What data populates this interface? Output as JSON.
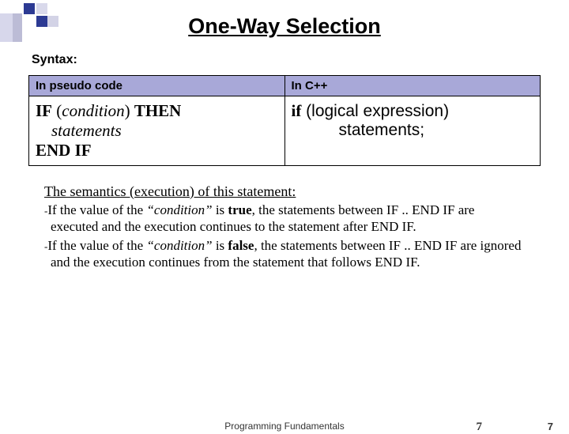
{
  "title": "One-Way Selection",
  "syntax_label": "Syntax:",
  "table": {
    "head_left": "In pseudo code",
    "head_right": "In C++",
    "pseudo": {
      "line1_kw1": "IF",
      "line1_paren_open": "  (",
      "line1_cond": "condition",
      "line1_paren_close": ") ",
      "line1_kw2": "THEN",
      "line2": "statements",
      "line3": "END IF"
    },
    "cpp": {
      "line1_kw": "if",
      "line1_rest": " (logical expression)",
      "line2": "statements;"
    }
  },
  "semantics": {
    "heading": "The semantics (execution) of this statement:",
    "p1_dash": "-",
    "p1_a": "If the value of the ",
    "p1_cond": "“condition”",
    "p1_b": " is ",
    "p1_true": "true",
    "p1_c": ", the statements between IF .. END IF are executed and the execution continues to the statement after END IF.",
    "p2_dash": "-",
    "p2_a": "If the value of the ",
    "p2_cond": "“condition”",
    "p2_b": " is ",
    "p2_false": "false",
    "p2_c": ", the statements between IF .. END IF are ignored and the execution continues from the statement that follows END IF."
  },
  "footer": {
    "center": "Programming Fundamentals",
    "num1": "7",
    "num2": "7"
  }
}
